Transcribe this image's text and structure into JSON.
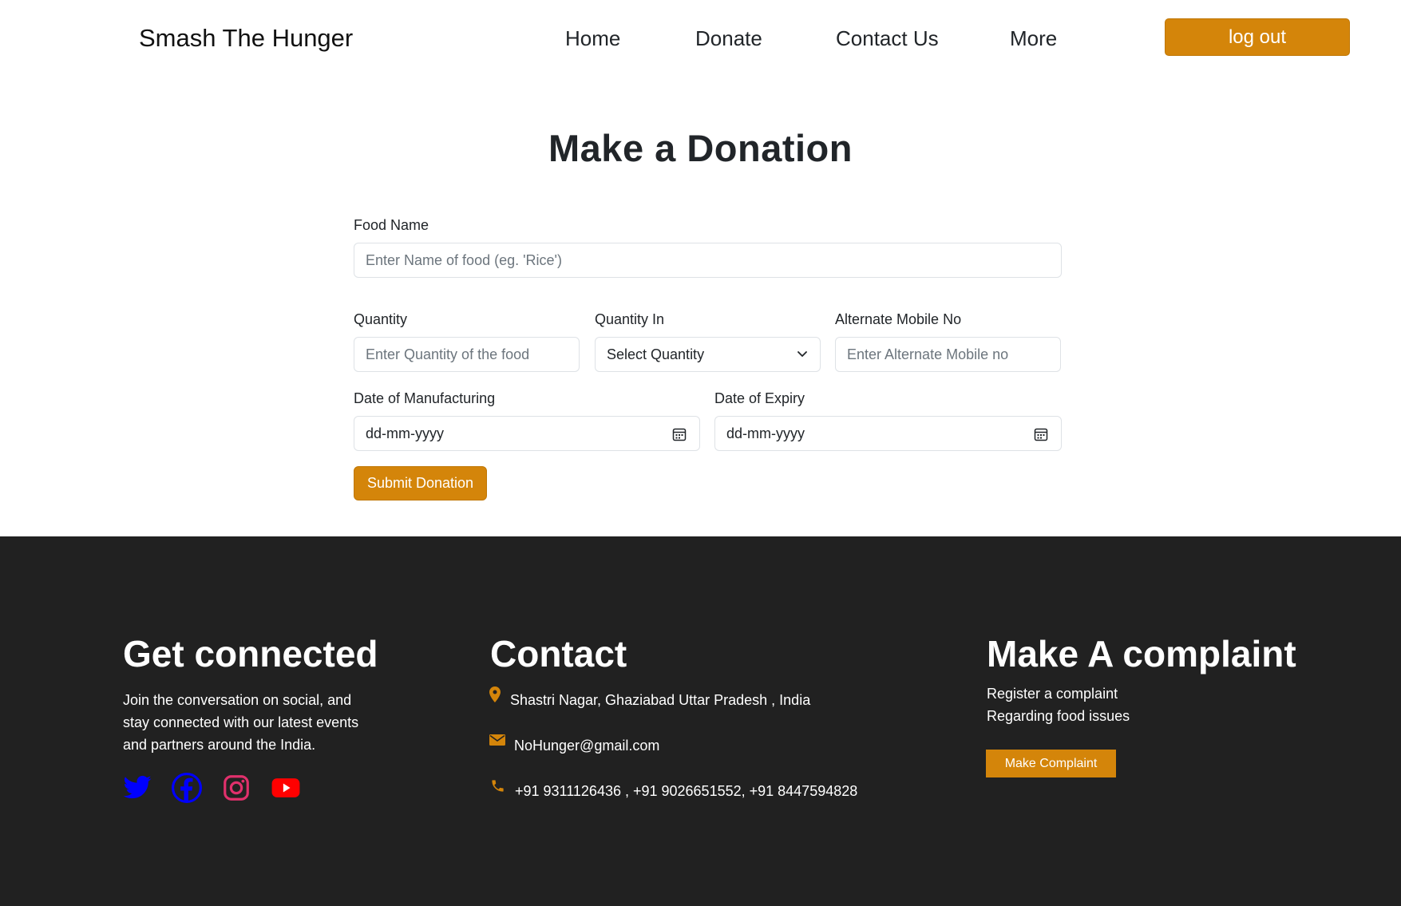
{
  "header": {
    "brand": "Smash The Hunger",
    "nav": {
      "home": "Home",
      "donate": "Donate",
      "contact": "Contact Us",
      "more": "More"
    },
    "logout_label": "log out"
  },
  "form": {
    "title": "Make a Donation",
    "food_name": {
      "label": "Food Name",
      "placeholder": "Enter Name of food (eg. 'Rice')"
    },
    "quantity": {
      "label": "Quantity",
      "placeholder": "Enter Quantity of the food"
    },
    "quantity_in": {
      "label": "Quantity In",
      "selected": "Select Quantity"
    },
    "alt_mobile": {
      "label": "Alternate Mobile No",
      "placeholder": "Enter Alternate Mobile no"
    },
    "date_mfg": {
      "label": "Date of Manufacturing",
      "value": "dd-mm-yyyy"
    },
    "date_exp": {
      "label": "Date of Expiry",
      "value": "dd-mm-yyyy"
    },
    "submit_label": "Submit Donation"
  },
  "footer": {
    "connected": {
      "heading": "Get connected",
      "text": "Join the conversation on social, and stay connected with our latest events and partners around the India.",
      "social": [
        {
          "icon": "twitter-icon",
          "color": "#0000ff"
        },
        {
          "icon": "facebook-icon",
          "color": "#0000ff"
        },
        {
          "icon": "instagram-icon",
          "color": "#e1306c"
        },
        {
          "icon": "youtube-icon",
          "color": "#ff0000"
        }
      ]
    },
    "contact": {
      "heading": "Contact",
      "address": "Shastri Nagar, Ghaziabad Uttar Pradesh , India",
      "email": "NoHunger@gmail.com",
      "phones": "+91 9311126436 , +91 9026651552, +91 8447594828"
    },
    "complaint": {
      "heading": "Make A complaint",
      "line1": "Register a complaint",
      "line2": "Regarding food issues",
      "button_label": "Make Complaint"
    }
  },
  "colors": {
    "accent": "#d4850a",
    "footer_bg": "#212121"
  }
}
